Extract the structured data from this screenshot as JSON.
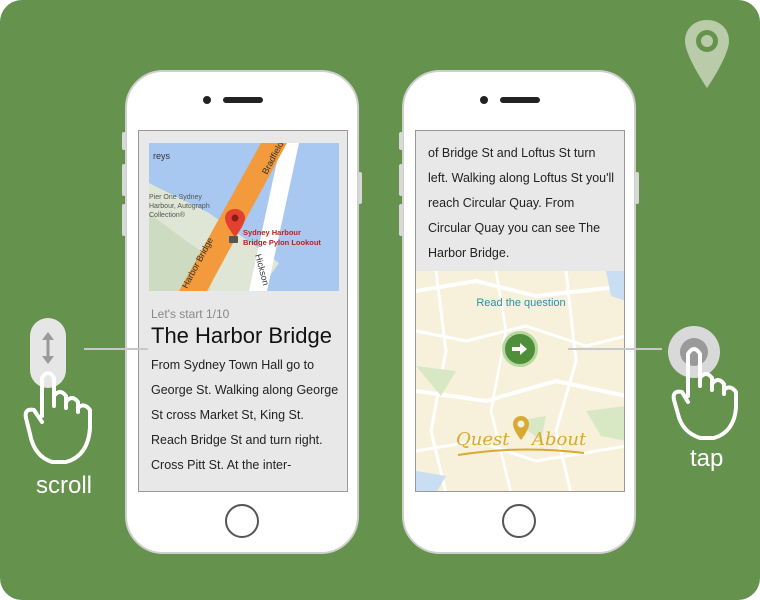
{
  "left_phone": {
    "map": {
      "labels": {
        "reys": "reys",
        "bradfield": "Bradfield",
        "harbor_bridge_road": "Harbor Bridge",
        "hickson": "Hickson",
        "pier_one_1": "Pier One Sydney",
        "pier_one_2": "Harbour, Autograph",
        "pier_one_3": "Collection®",
        "poi_1": "Sydney Harbour",
        "poi_2": "Bridge Pylon Lookout"
      }
    },
    "subtitle": "Let's start 1/10",
    "title": "The Harbor Bridge",
    "paragraph": "From Sydney Town Hall go to George St. Walking along George St cross Market St, King St. Reach Bridge St and turn right. Cross Pitt St. At the inter-"
  },
  "right_phone": {
    "paragraph": "of Bridge St and Loftus St turn left. Walking along Loftus St you'll reach Circular Quay. From Circular Quay you can see The Harbor Bridge.",
    "read_question": "Read the question",
    "next_icon": "arrow-right-icon",
    "logo_left": "Quest",
    "logo_right": "About"
  },
  "gestures": {
    "scroll_label": "scroll",
    "tap_label": "tap"
  },
  "colors": {
    "panel_green": "#65924d",
    "map_orange": "#f29a3c",
    "map_water": "#a9c8f1",
    "logo_gold": "#d8a933"
  }
}
